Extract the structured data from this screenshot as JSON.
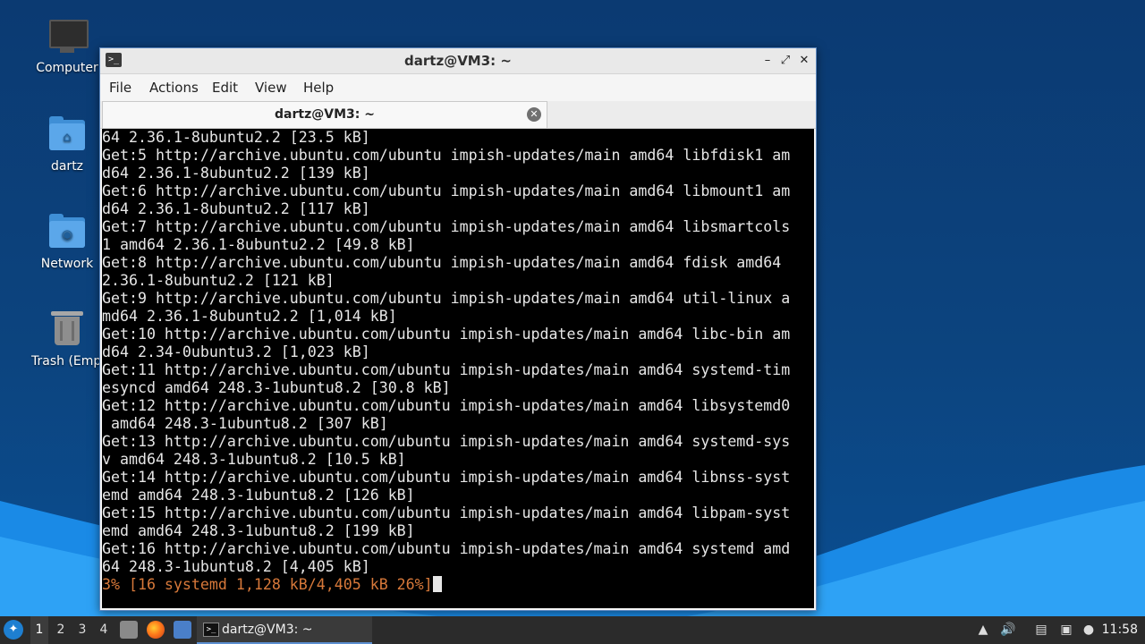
{
  "desktop": {
    "icons": [
      {
        "label": "Computer",
        "icon": "computer-icon"
      },
      {
        "label": "dartz",
        "icon": "home-folder-icon"
      },
      {
        "label": "Network",
        "icon": "network-folder-icon"
      },
      {
        "label": "Trash (Empt",
        "icon": "trash-icon"
      }
    ]
  },
  "window": {
    "title": "dartz@VM3: ~",
    "controls": {
      "minimize": "–",
      "maximize": "⤢",
      "close": "✕"
    },
    "menu": [
      "File",
      "Actions",
      "Edit",
      "View",
      "Help"
    ],
    "tab": {
      "label": "dartz@VM3: ~",
      "close": "✕"
    }
  },
  "terminal": {
    "lines": [
      "64 2.36.1-8ubuntu2.2 [23.5 kB]",
      "Get:5 http://archive.ubuntu.com/ubuntu impish-updates/main amd64 libfdisk1 am",
      "d64 2.36.1-8ubuntu2.2 [139 kB]",
      "Get:6 http://archive.ubuntu.com/ubuntu impish-updates/main amd64 libmount1 am",
      "d64 2.36.1-8ubuntu2.2 [117 kB]",
      "Get:7 http://archive.ubuntu.com/ubuntu impish-updates/main amd64 libsmartcols",
      "1 amd64 2.36.1-8ubuntu2.2 [49.8 kB]",
      "Get:8 http://archive.ubuntu.com/ubuntu impish-updates/main amd64 fdisk amd64",
      "2.36.1-8ubuntu2.2 [121 kB]",
      "Get:9 http://archive.ubuntu.com/ubuntu impish-updates/main amd64 util-linux a",
      "md64 2.36.1-8ubuntu2.2 [1,014 kB]",
      "Get:10 http://archive.ubuntu.com/ubuntu impish-updates/main amd64 libc-bin am",
      "d64 2.34-0ubuntu3.2 [1,023 kB]",
      "Get:11 http://archive.ubuntu.com/ubuntu impish-updates/main amd64 systemd-tim",
      "esyncd amd64 248.3-1ubuntu8.2 [30.8 kB]",
      "Get:12 http://archive.ubuntu.com/ubuntu impish-updates/main amd64 libsystemd0",
      " amd64 248.3-1ubuntu8.2 [307 kB]",
      "Get:13 http://archive.ubuntu.com/ubuntu impish-updates/main amd64 systemd-sys",
      "v amd64 248.3-1ubuntu8.2 [10.5 kB]",
      "Get:14 http://archive.ubuntu.com/ubuntu impish-updates/main amd64 libnss-syst",
      "emd amd64 248.3-1ubuntu8.2 [126 kB]",
      "Get:15 http://archive.ubuntu.com/ubuntu impish-updates/main amd64 libpam-syst",
      "emd amd64 248.3-1ubuntu8.2 [199 kB]",
      "Get:16 http://archive.ubuntu.com/ubuntu impish-updates/main amd64 systemd amd",
      "64 248.3-1ubuntu8.2 [4,405 kB]"
    ],
    "progress_line": "3% [16 systemd 1,128 kB/4,405 kB 26%]",
    "progress_color": "#d8793a"
  },
  "taskbar": {
    "workspaces": [
      "1",
      "2",
      "3",
      "4"
    ],
    "active_workspace": "1",
    "task_label": "dartz@VM3: ~",
    "clock": "11:58",
    "colors": {
      "background": "#2b2b2b",
      "accent": "#5c8fd0"
    }
  }
}
